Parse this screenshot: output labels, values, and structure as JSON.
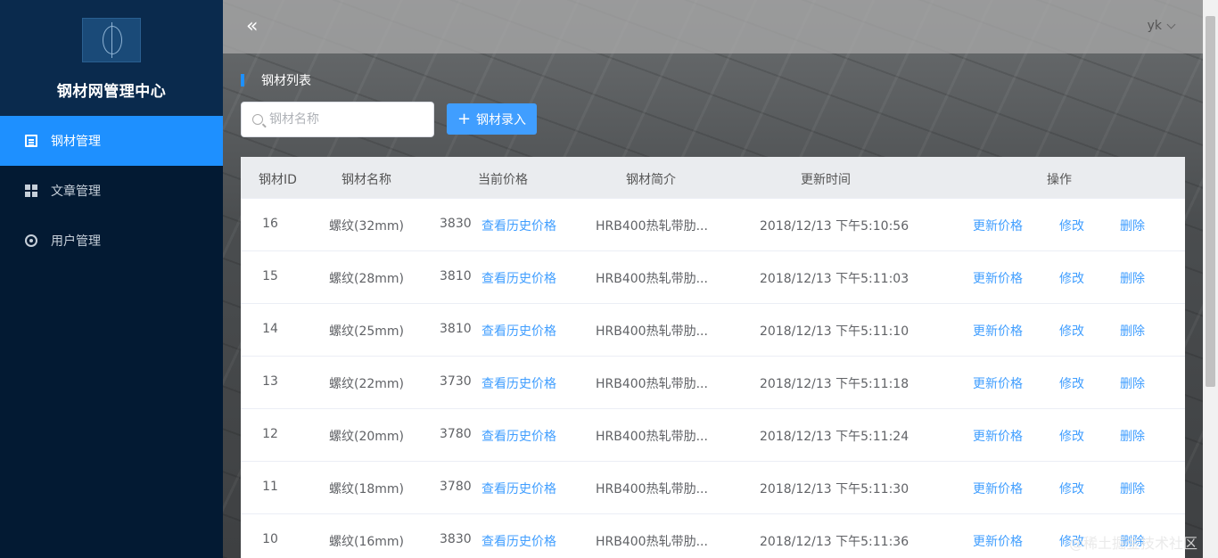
{
  "sidebar": {
    "title": "钢材网管理中心",
    "items": [
      {
        "label": "钢材管理",
        "icon": "list-icon",
        "active": true
      },
      {
        "label": "文章管理",
        "icon": "grid-icon",
        "active": false
      },
      {
        "label": "用户管理",
        "icon": "gear-icon",
        "active": false
      }
    ]
  },
  "header": {
    "collapse_icon": "«",
    "user": "yk"
  },
  "page": {
    "title": "钢材列表",
    "search_placeholder": "钢材名称",
    "add_label": "钢材录入"
  },
  "table": {
    "headers": {
      "id": "钢材ID",
      "name": "钢材名称",
      "price": "当前价格",
      "desc": "钢材简介",
      "time": "更新时间",
      "ops": "操作"
    },
    "actions": {
      "history": "查看历史价格",
      "update": "更新价格",
      "edit": "修改",
      "delete": "删除"
    },
    "rows": [
      {
        "id": "16",
        "name": "螺纹(32mm)",
        "price": "3830",
        "desc": "HRB400热轧带肋...",
        "time": "2018/12/13 下午5:10:56"
      },
      {
        "id": "15",
        "name": "螺纹(28mm)",
        "price": "3810",
        "desc": "HRB400热轧带肋...",
        "time": "2018/12/13 下午5:11:03"
      },
      {
        "id": "14",
        "name": "螺纹(25mm)",
        "price": "3810",
        "desc": "HRB400热轧带肋...",
        "time": "2018/12/13 下午5:11:10"
      },
      {
        "id": "13",
        "name": "螺纹(22mm)",
        "price": "3730",
        "desc": "HRB400热轧带肋...",
        "time": "2018/12/13 下午5:11:18"
      },
      {
        "id": "12",
        "name": "螺纹(20mm)",
        "price": "3780",
        "desc": "HRB400热轧带肋...",
        "time": "2018/12/13 下午5:11:24"
      },
      {
        "id": "11",
        "name": "螺纹(18mm)",
        "price": "3780",
        "desc": "HRB400热轧带肋...",
        "time": "2018/12/13 下午5:11:30"
      },
      {
        "id": "10",
        "name": "螺纹(16mm)",
        "price": "3830",
        "desc": "HRB400热轧带肋...",
        "time": "2018/12/13 下午5:11:36"
      }
    ]
  },
  "watermark": "@稀土掘金技术社区"
}
